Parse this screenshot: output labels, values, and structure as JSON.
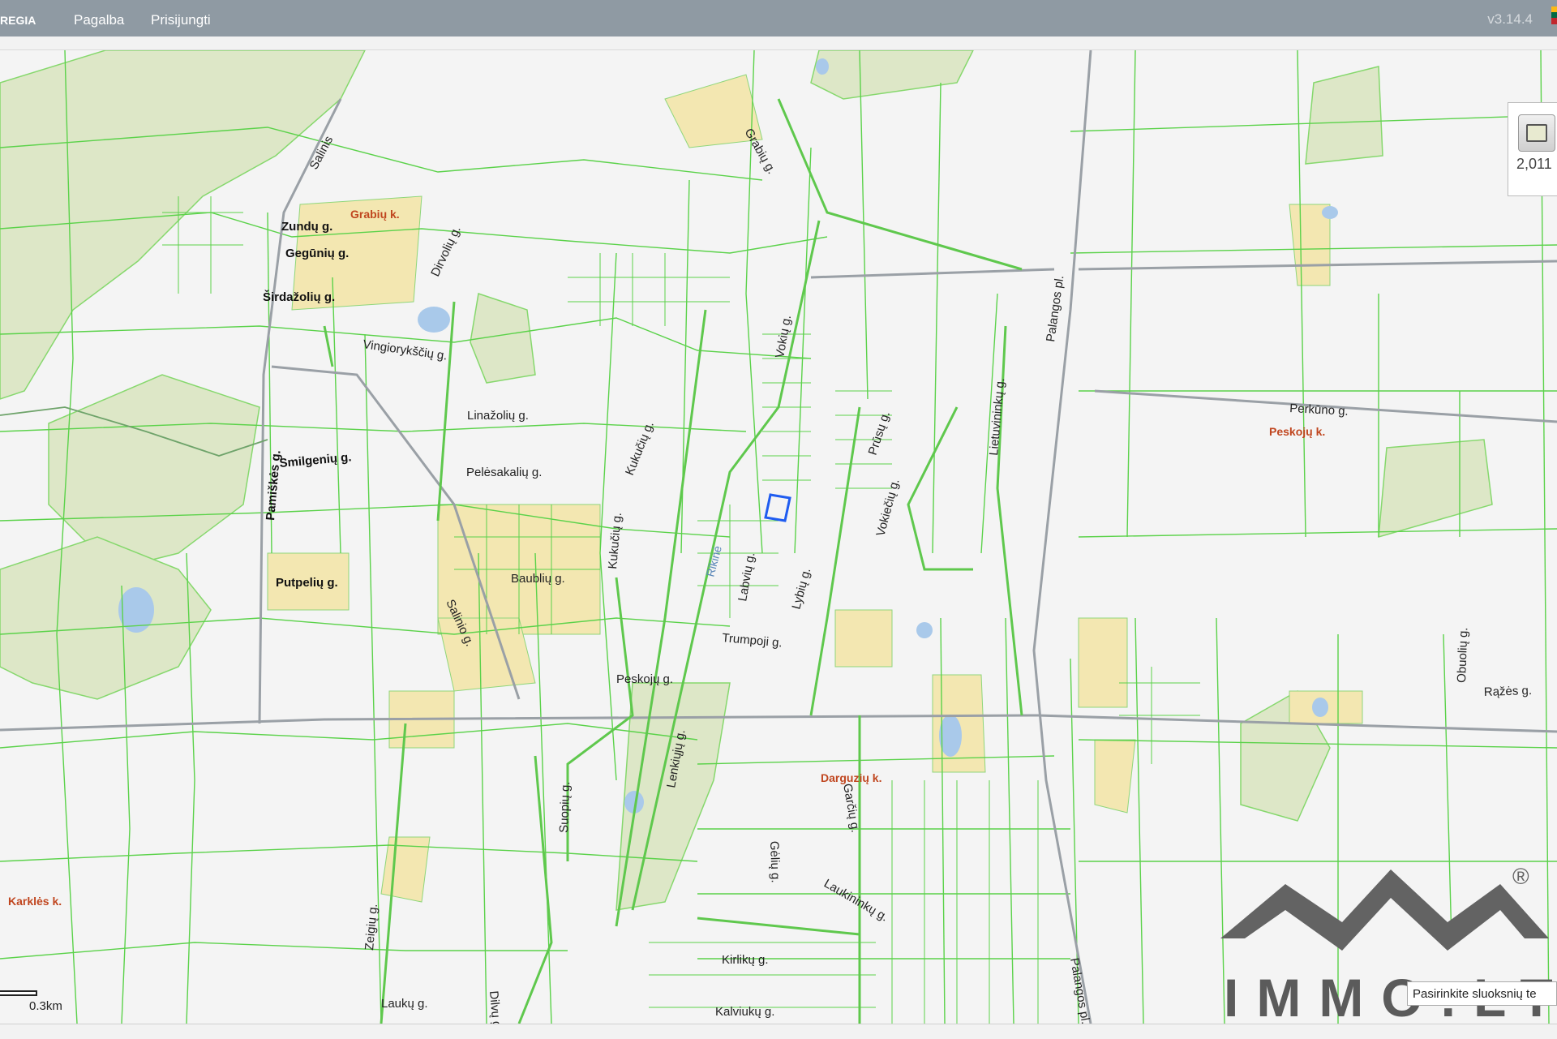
{
  "topbar": {
    "brand": "REGIA",
    "menu": [
      "Pagalba",
      "Prisijungti"
    ],
    "version": "v3.14.4"
  },
  "layer_panel": {
    "value": "2,011"
  },
  "scale": {
    "label": "0.3km"
  },
  "layer_select": {
    "placeholder": "Pasirinkite sluoksnių te"
  },
  "logo": {
    "text": "IMMO.LT",
    "registered": "®"
  },
  "map": {
    "streets": [
      "Salinis",
      "Zundų g.",
      "Gegūnių g.",
      "Širdažolių g.",
      "Dirvolių g.",
      "Vingiorykščių g.",
      "Linažolių g.",
      "Smilgenių g.",
      "Pelėsakalių g.",
      "Pamiškės g.",
      "Salinio g.",
      "Baublių g.",
      "Putpelių g.",
      "Kukučių g.",
      "Kukučių g.",
      "Grabių g.",
      "Vokių g.",
      "Labvių g.",
      "Lybių g.",
      "Prūsų g.",
      "Lietuvininkų g.",
      "Vokiečių g.",
      "Trumpoji g.",
      "Peskojų g.",
      "Palangos pl.",
      "Perkūno g.",
      "Obuolių g.",
      "Rąžės g.",
      "Lenkiųjų g.",
      "Suopių g.",
      "Gėlių g.",
      "Garčių g.",
      "Laukininkų g.",
      "Kirlikų g.",
      "Zeigių g.",
      "Laukų g.",
      "Dilvų g.",
      "Kalviukų g.",
      "Palangos pl."
    ],
    "villages": [
      "Grabių k.",
      "Peskojų k.",
      "Darguzių k.",
      "Karklės k."
    ],
    "rivers": [
      "Rikinė"
    ]
  },
  "colors": {
    "parcel_line": "#5bd24a",
    "road": "#9aa0a6",
    "settlement": "#f3e7b1",
    "forest": "#dde7c7",
    "water": "#a9c9ea",
    "selected_parcel": "#1f5cf0",
    "topbar": "#8f9aa3"
  }
}
